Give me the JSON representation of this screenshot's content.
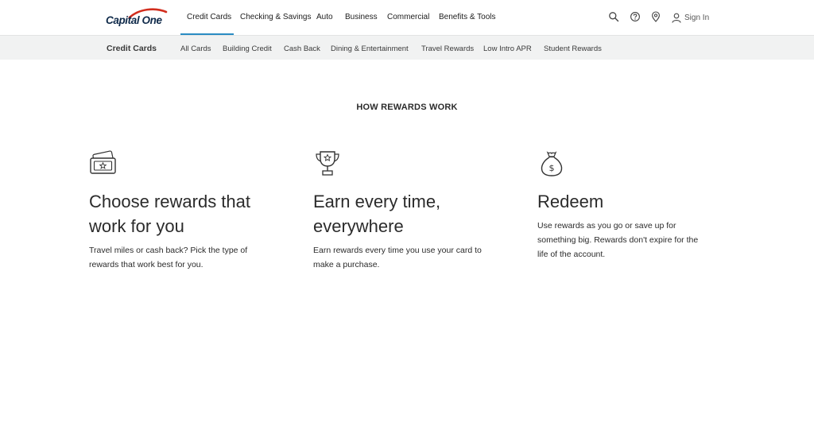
{
  "brand": {
    "logo_text": "Capital One",
    "accent_color": "#2a8cc3",
    "logo_red": "#d22e1e",
    "logo_navy": "#0f2a4a"
  },
  "topnav": {
    "links": [
      {
        "label": "Credit Cards",
        "active": true
      },
      {
        "label": "Checking & Savings"
      },
      {
        "label": "Auto"
      },
      {
        "label": "Business"
      },
      {
        "label": "Commercial"
      },
      {
        "label": "Benefits & Tools"
      }
    ],
    "utilities": {
      "search_icon": "search-icon",
      "help_icon": "help-icon",
      "location_icon": "location-pin-icon",
      "signin_icon": "user-icon",
      "signin_label": "Sign In"
    }
  },
  "subnav": {
    "title": "Credit Cards",
    "links": [
      {
        "label": "All Cards"
      },
      {
        "label": "Building Credit"
      },
      {
        "label": "Cash Back"
      },
      {
        "label": "Dining & Entertainment"
      },
      {
        "label": "Travel Rewards"
      },
      {
        "label": "Low Intro APR"
      },
      {
        "label": "Student Rewards"
      }
    ]
  },
  "main": {
    "heading": "HOW REWARDS WORK",
    "columns": [
      {
        "icon": "rewards-ticket-icon",
        "title_line1": "Choose rewards that",
        "title_line2": "work for you",
        "body_line1": "Travel miles or cash back? Pick the type of",
        "body_line2": "rewards that work best for you."
      },
      {
        "icon": "trophy-icon",
        "title_line1": "Earn every time,",
        "title_line2": "everywhere",
        "body_line1": "Earn rewards every time you use your card to",
        "body_line2": "make a purchase."
      },
      {
        "icon": "money-bag-icon",
        "title_line1": "Redeem",
        "body_line1": "Use rewards as you go or save up for",
        "body_line2": "something big. Rewards don't expire for the",
        "body_line3": "life of the account."
      }
    ]
  }
}
